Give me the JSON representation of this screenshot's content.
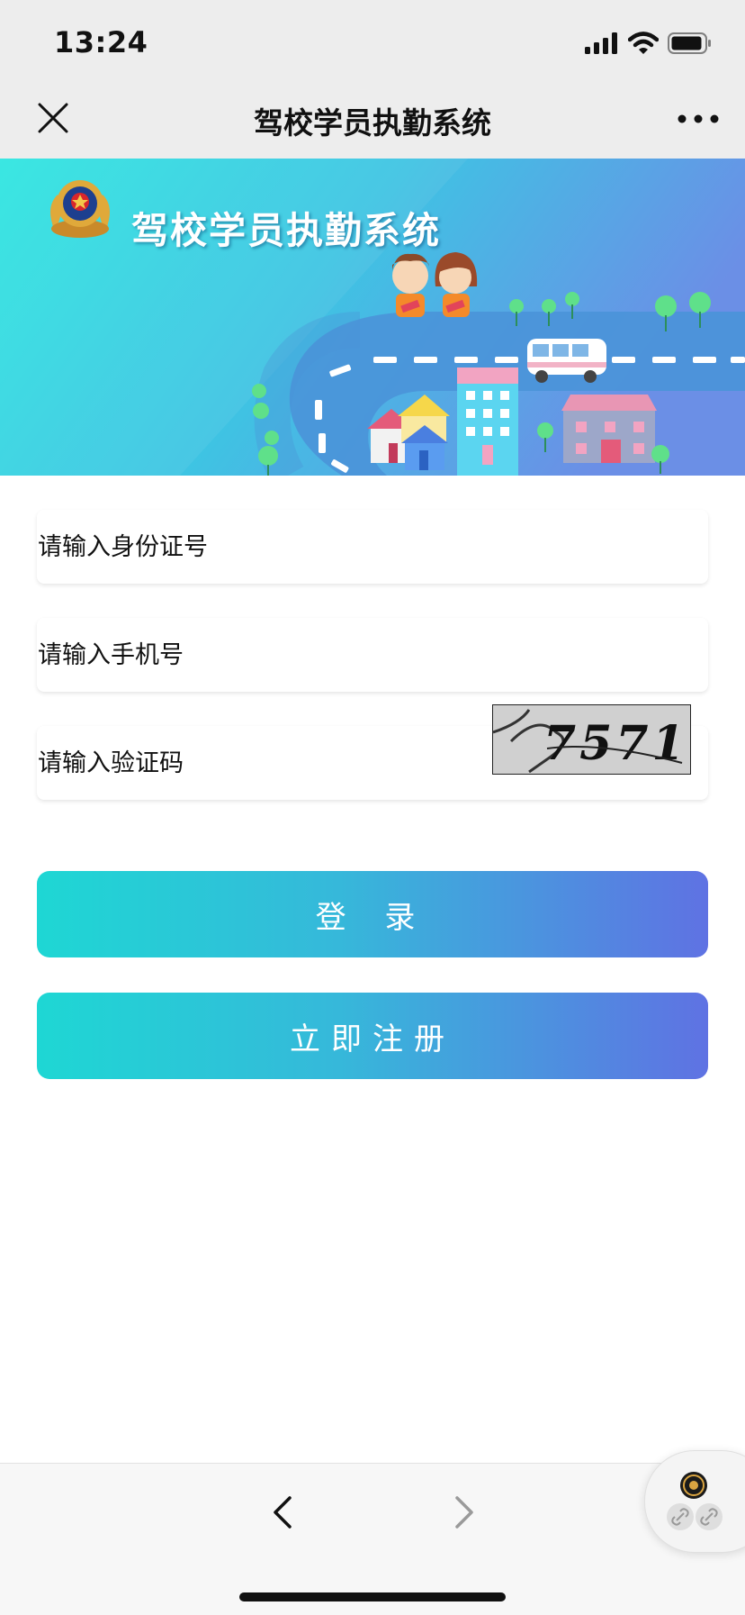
{
  "status_bar": {
    "time": "13:24"
  },
  "nav": {
    "title": "驾校学员执勤系统",
    "close_icon": "close-icon",
    "more_icon": "more-dots-icon"
  },
  "banner": {
    "title": "驾校学员执勤系统",
    "emblem_icon": "police-emblem-icon"
  },
  "form": {
    "id_placeholder": "请输入身份证号",
    "id_value": "",
    "phone_placeholder": "请输入手机号",
    "phone_value": "",
    "code_placeholder": "请输入验证码",
    "code_value": "",
    "captcha_text": "7571"
  },
  "buttons": {
    "login": "登 录",
    "register": "立即注册"
  },
  "colors": {
    "button_gradient_start": "#1ed7d4",
    "button_gradient_end": "#5f72e3",
    "banner_start": "#2ee6e1",
    "banner_end": "#6b8fe6"
  },
  "toolbar": {
    "back_icon": "chevron-left-icon",
    "forward_icon": "chevron-right-icon"
  }
}
